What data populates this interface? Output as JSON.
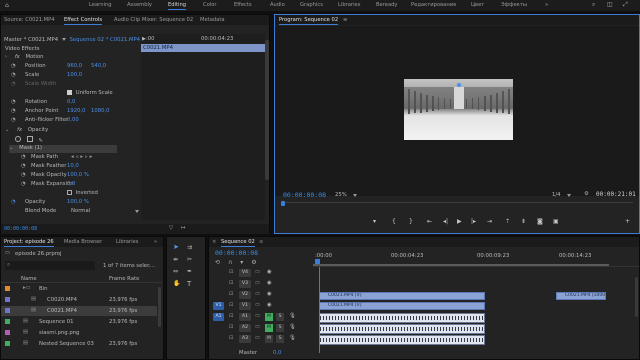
{
  "workspaces": {
    "items": [
      "Learning",
      "Assembly",
      "Editing",
      "Color",
      "Effects",
      "Audio",
      "Graphics",
      "Libraries",
      "Beready",
      "Редактирование",
      "Цвет",
      "Эффекты"
    ],
    "active": "Editing"
  },
  "source_panel": {
    "tabs": [
      "Source: C0021.MP4",
      "Effect Controls",
      "Audio Clip Mixer: Sequence 02",
      "Metadata"
    ],
    "active_tab": "Effect Controls",
    "breadcrumb_master": "Master * C0021.MP4",
    "breadcrumb_seq": "Sequence 02 * C0021.MP4",
    "ruler_start": ":00",
    "ruler_mid": "00:00:04:23",
    "clip_label": "C0021.MP4",
    "section_video_effects": "Video Effects",
    "motion": "Motion",
    "position_label": "Position",
    "position_x": "960,0",
    "position_y": "540,0",
    "scale_label": "Scale",
    "scale_value": "100,0",
    "scale_width_label": "Scale Width",
    "uniform_scale_label": "Uniform Scale",
    "rotation_label": "Rotation",
    "rotation_value": "0,0",
    "anchor_label": "Anchor Point",
    "anchor_x": "1920,0",
    "anchor_y": "1080,0",
    "antiflicker_label": "Anti-flicker Filter",
    "antiflicker_value": "0,00",
    "opacity_section": "Opacity",
    "mask_label": "Mask (1)",
    "mask_path_label": "Mask Path",
    "mask_feather_label": "Mask Feather",
    "mask_feather_value": "10,0",
    "mask_opacity_label": "Mask Opacity",
    "mask_opacity_value": "100,0 %",
    "mask_expansion_label": "Mask Expansion",
    "mask_expansion_value": "0,0",
    "inverted_label": "Inverted",
    "opacity_label": "Opacity",
    "opacity_value": "100,0 %",
    "blend_label": "Blend Mode",
    "blend_value": "Normal",
    "footer_tc": "00:00:00:08"
  },
  "program_monitor": {
    "title": "Program: Sequence 02",
    "timecode": "00:00:00:08",
    "zoom": "25%",
    "fraction": "1/4",
    "duration": "00:00:21:01"
  },
  "project_panel": {
    "tabs": [
      "Project: episode 26",
      "Media Browser",
      "Libraries"
    ],
    "active_tab": "Project: episode 26",
    "file": "episode 26.prproj",
    "selection_info": "1 of 7 items selec...",
    "col_name": "Name",
    "col_rate": "Frame Rate",
    "items": [
      {
        "name": "Bin",
        "rate": "",
        "color": "#e08b2e",
        "indent": 0,
        "type": "bin"
      },
      {
        "name": "C0020.MP4",
        "rate": "23,976 fps",
        "color": "#6f76c9",
        "indent": 1,
        "type": "clip"
      },
      {
        "name": "C0021.MP4",
        "rate": "23,976 fps",
        "color": "#6f76c9",
        "indent": 1,
        "type": "clip"
      },
      {
        "name": "Sequence 01",
        "rate": "23,976 fps",
        "color": "#3fae5f",
        "indent": 0,
        "type": "seq"
      },
      {
        "name": "siasmi.png.png",
        "rate": "",
        "color": "#b25db0",
        "indent": 0,
        "type": "img"
      },
      {
        "name": "Nested Sequence 03",
        "rate": "23,976 fps",
        "color": "#3fae5f",
        "indent": 0,
        "type": "seq"
      }
    ]
  },
  "timeline": {
    "tab": "Sequence 02",
    "timecode": "00:00:00:08",
    "ruler": [
      ":00:00",
      "00:00:04:23",
      "00:00:09:23",
      "00:00:14:23"
    ],
    "video_tracks": [
      "V4",
      "V3",
      "V2",
      "V1"
    ],
    "audio_tracks": [
      "A1",
      "A2",
      "A3"
    ],
    "master_label": "Master",
    "master_value": "0,0",
    "clip_v2": "C0021.MP4 [V]",
    "clip_v1": "C0021.MP4 [V]",
    "clip_v2_right": "C0021.MP4 [1000%]"
  }
}
